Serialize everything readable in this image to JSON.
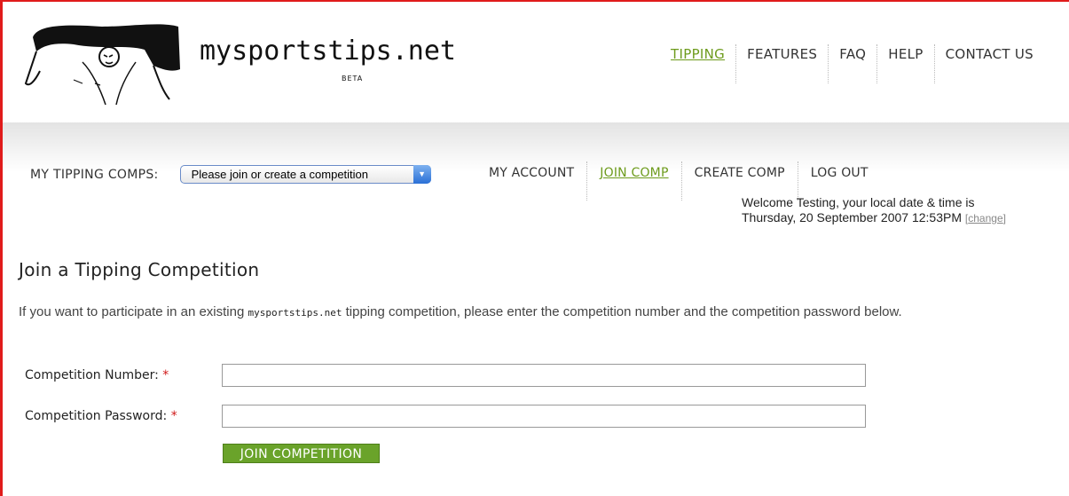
{
  "header": {
    "brand": "mysportstips.net",
    "beta": "BETA",
    "nav": [
      {
        "label": "TIPPING",
        "active": true
      },
      {
        "label": "FEATURES",
        "active": false
      },
      {
        "label": "FAQ",
        "active": false
      },
      {
        "label": "HELP",
        "active": false
      },
      {
        "label": "CONTACT US",
        "active": false
      }
    ]
  },
  "subnav": {
    "comps_label": "MY TIPPING COMPS:",
    "comps_select_value": "Please join or create a competition",
    "links": [
      {
        "label": "MY ACCOUNT",
        "active": false
      },
      {
        "label": "JOIN COMP",
        "active": true
      },
      {
        "label": "CREATE COMP",
        "active": false
      },
      {
        "label": "LOG OUT",
        "active": false
      }
    ]
  },
  "welcome": {
    "line1": "Welcome Testing, your local date & time is",
    "line2": "Thursday, 20 September 2007 12:53PM",
    "change_link": "change"
  },
  "content": {
    "title": "Join a Tipping Competition",
    "intro_before": "If you want to participate in an existing ",
    "intro_brand": "mysportstips.net",
    "intro_after": " tipping competition, please enter the competition number and the competition password below.",
    "fields": {
      "number_label": "Competition Number:",
      "password_label": "Competition Password:",
      "required_mark": "*",
      "number_value": "",
      "password_value": ""
    },
    "submit_label": "JOIN COMPETITION"
  },
  "colors": {
    "accent_green": "#6d9b1c",
    "button_green": "#6aa32a",
    "required_red": "#d01818",
    "frame_red": "#e01b1b"
  }
}
